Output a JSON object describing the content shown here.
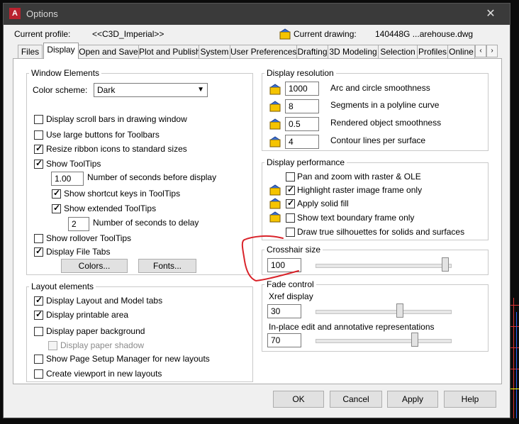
{
  "window": {
    "title": "Options",
    "app_icon_letter": "A",
    "close_glyph": "✕"
  },
  "profile": {
    "label": "Current profile:",
    "value": "<<C3D_Imperial>>"
  },
  "drawing": {
    "label": "Current drawing:",
    "value": "140448G ...arehouse.dwg"
  },
  "tabs": [
    "Files",
    "Display",
    "Open and Save",
    "Plot and Publish",
    "System",
    "User Preferences",
    "Drafting",
    "3D Modeling",
    "Selection",
    "Profiles",
    "Online"
  ],
  "active_tab": "Display",
  "tab_scroll": {
    "left": "‹",
    "right": "›"
  },
  "window_elements": {
    "title": "Window Elements",
    "color_scheme_label": "Color scheme:",
    "color_scheme_value": "Dark",
    "scroll_bars": {
      "label": "Display scroll bars in drawing window",
      "checked": false
    },
    "large_buttons": {
      "label": "Use large buttons for Toolbars",
      "checked": false
    },
    "resize_ribbon": {
      "label": "Resize ribbon icons to standard sizes",
      "checked": true
    },
    "show_tooltips": {
      "label": "Show ToolTips",
      "checked": true
    },
    "tooltip_delay": {
      "value": "1.00",
      "label": "Number of seconds before display"
    },
    "shortcut_keys": {
      "label": "Show shortcut keys in ToolTips",
      "checked": true
    },
    "extended_tooltips": {
      "label": "Show extended ToolTips",
      "checked": true
    },
    "extended_delay": {
      "value": "2",
      "label": "Number of seconds to delay"
    },
    "rollover": {
      "label": "Show rollover ToolTips",
      "checked": false
    },
    "file_tabs": {
      "label": "Display File Tabs",
      "checked": true
    },
    "colors_button": "Colors...",
    "fonts_button": "Fonts..."
  },
  "layout_elements": {
    "title": "Layout elements",
    "layout_model_tabs": {
      "label": "Display Layout and Model tabs",
      "checked": true
    },
    "printable_area": {
      "label": "Display printable area",
      "checked": true
    },
    "paper_background": {
      "label": "Display paper background",
      "checked": false
    },
    "paper_shadow": {
      "label": "Display paper shadow",
      "checked": false,
      "disabled": true
    },
    "page_setup": {
      "label": "Show Page Setup Manager for new layouts",
      "checked": false
    },
    "create_viewport": {
      "label": "Create viewport in new layouts",
      "checked": false
    }
  },
  "display_resolution": {
    "title": "Display resolution",
    "rows": [
      {
        "value": "1000",
        "label": "Arc and circle smoothness"
      },
      {
        "value": "8",
        "label": "Segments in a polyline curve"
      },
      {
        "value": "0.5",
        "label": "Rendered object smoothness"
      },
      {
        "value": "4",
        "label": "Contour lines per surface"
      }
    ]
  },
  "display_performance": {
    "title": "Display performance",
    "pan_zoom": {
      "label": "Pan and zoom with raster & OLE",
      "checked": false
    },
    "highlight_raster": {
      "label": "Highlight raster image frame only",
      "checked": true
    },
    "solid_fill": {
      "label": "Apply solid fill",
      "checked": true
    },
    "text_boundary": {
      "label": "Show text boundary frame only",
      "checked": false
    },
    "silhouettes": {
      "label": "Draw true silhouettes for solids and surfaces",
      "checked": false
    }
  },
  "crosshair": {
    "title": "Crosshair size",
    "value": "100",
    "level": 1.0
  },
  "fade_control": {
    "title": "Fade control",
    "xref_label": "Xref display",
    "xref_value": "30",
    "xref_level": 0.64,
    "inplace_label": "In-place edit and annotative representations",
    "inplace_value": "70",
    "inplace_level": 0.76
  },
  "footer": {
    "ok": "OK",
    "cancel": "Cancel",
    "apply": "Apply",
    "help": "Help"
  },
  "check_glyph": "✓",
  "dropdown_glyph": "▼",
  "colors": {
    "titlebar": "#3a3a3a",
    "annotation": "#d9232a",
    "acad_icon": "#f5c400"
  }
}
